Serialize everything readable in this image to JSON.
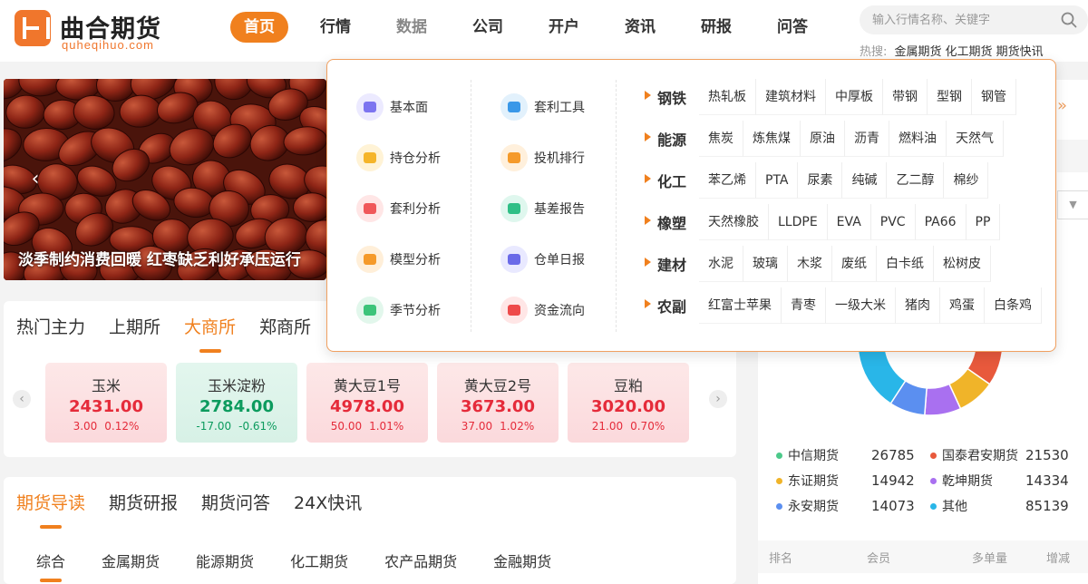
{
  "logo": {
    "name": "曲合期货",
    "domain": "quheqihuo.com"
  },
  "nav": [
    {
      "label": "首页"
    },
    {
      "label": "行情"
    },
    {
      "label": "数据"
    },
    {
      "label": "公司"
    },
    {
      "label": "开户"
    },
    {
      "label": "资讯"
    },
    {
      "label": "研报"
    },
    {
      "label": "问答"
    }
  ],
  "search": {
    "placeholder": "输入行情名称、关键字",
    "hot_label": "热搜:",
    "hot_keywords": [
      "金属期货",
      "化工期货",
      "期货快讯"
    ]
  },
  "banner": {
    "caption": "淡季制约消费回暖 红枣缺乏利好承压运行"
  },
  "market": {
    "tabs": [
      "热门主力",
      "上期所",
      "大商所",
      "郑商所"
    ],
    "quotes": [
      {
        "name": "玉米",
        "price": "2431.00",
        "change": "3.00",
        "pct": "0.12%",
        "dir": "up"
      },
      {
        "name": "玉米淀粉",
        "price": "2784.00",
        "change": "-17.00",
        "pct": "-0.61%",
        "dir": "down"
      },
      {
        "name": "黄大豆1号",
        "price": "4978.00",
        "change": "50.00",
        "pct": "1.01%",
        "dir": "up"
      },
      {
        "name": "黄大豆2号",
        "price": "3673.00",
        "change": "37.00",
        "pct": "1.02%",
        "dir": "up"
      },
      {
        "name": "豆粕",
        "price": "3020.00",
        "change": "21.00",
        "pct": "0.70%",
        "dir": "up"
      }
    ]
  },
  "articles": {
    "tabs": [
      "期货导读",
      "期货研报",
      "期货问答",
      "24X快讯"
    ],
    "sub_tabs": [
      "综合",
      "金属期货",
      "能源期货",
      "化工期货",
      "农产品期货",
      "金融期货"
    ]
  },
  "share": {
    "legend": [
      {
        "name": "中信期货",
        "value": "26785",
        "color": "#4cc98a"
      },
      {
        "name": "国泰君安期货",
        "value": "21530",
        "color": "#e8593c"
      },
      {
        "name": "东证期货",
        "value": "14942",
        "color": "#f0b429"
      },
      {
        "name": "乾坤期货",
        "value": "14334",
        "color": "#a970f0"
      },
      {
        "name": "永安期货",
        "value": "14073",
        "color": "#5b8ff0"
      },
      {
        "name": "其他",
        "value": "85139",
        "color": "#29b6e8"
      }
    ],
    "rank_head": [
      "排名",
      "会员",
      "多单量",
      "增减"
    ]
  },
  "dropdown": {
    "col1": [
      {
        "label": "基本面",
        "icon": "fundamentals-icon",
        "bg": "#eceaff",
        "fg": "#7c74f0"
      },
      {
        "label": "持仓分析",
        "icon": "position-analysis-icon",
        "bg": "#fff3d6",
        "fg": "#f5b52a"
      },
      {
        "label": "套利分析",
        "icon": "arbitrage-analysis-icon",
        "bg": "#ffe6e6",
        "fg": "#f0585a"
      },
      {
        "label": "模型分析",
        "icon": "model-analysis-icon",
        "bg": "#ffefd9",
        "fg": "#f59a2a"
      },
      {
        "label": "季节分析",
        "icon": "seasonal-analysis-icon",
        "bg": "#e2f7ec",
        "fg": "#3cc47a"
      }
    ],
    "col2": [
      {
        "label": "套利工具",
        "icon": "arbitrage-tool-icon",
        "bg": "#e2f1fc",
        "fg": "#3a98e8"
      },
      {
        "label": "投机排行",
        "icon": "speculation-rank-icon",
        "bg": "#fff0dc",
        "fg": "#f59a2a"
      },
      {
        "label": "基差报告",
        "icon": "basis-report-icon",
        "bg": "#dff7ee",
        "fg": "#2fbf86"
      },
      {
        "label": "仓单日报",
        "icon": "warehouse-receipt-icon",
        "bg": "#e9e9ff",
        "fg": "#6a6ae8"
      },
      {
        "label": "资金流向",
        "icon": "capital-flow-icon",
        "bg": "#ffe6e6",
        "fg": "#ee4a4a"
      }
    ],
    "categories": [
      {
        "name": "钢铁",
        "items": [
          "热轧板",
          "建筑材料",
          "中厚板",
          "带钢",
          "型钢",
          "钢管"
        ]
      },
      {
        "name": "能源",
        "items": [
          "焦炭",
          "炼焦煤",
          "原油",
          "沥青",
          "燃料油",
          "天然气"
        ]
      },
      {
        "name": "化工",
        "items": [
          "苯乙烯",
          "PTA",
          "尿素",
          "纯碱",
          "乙二醇",
          "棉纱"
        ]
      },
      {
        "name": "橡塑",
        "items": [
          "天然橡胶",
          "LLDPE",
          "EVA",
          "PVC",
          "PA66",
          "PP"
        ]
      },
      {
        "name": "建材",
        "items": [
          "水泥",
          "玻璃",
          "木浆",
          "废纸",
          "白卡纸",
          "松树皮"
        ]
      },
      {
        "name": "农副",
        "items": [
          "红富士苹果",
          "青枣",
          "一级大米",
          "猪肉",
          "鸡蛋",
          "白条鸡"
        ]
      }
    ]
  },
  "colors": {
    "accent": "#f0801e",
    "up": "#e52b3a",
    "down": "#0c9b5e"
  }
}
